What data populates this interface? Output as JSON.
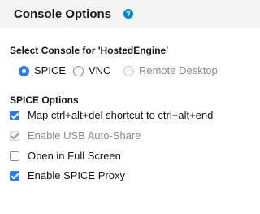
{
  "header": {
    "title": "Console Options",
    "help_icon": "?"
  },
  "console_select": {
    "label": "Select Console for 'HostedEngine'",
    "options": [
      {
        "label": "SPICE",
        "selected": true,
        "disabled": false
      },
      {
        "label": "VNC",
        "selected": false,
        "disabled": false
      },
      {
        "label": "Remote Desktop",
        "selected": false,
        "disabled": true
      }
    ]
  },
  "spice_options": {
    "label": "SPICE Options",
    "items": [
      {
        "label": "Map ctrl+alt+del shortcut to ctrl+alt+end",
        "checked": true,
        "disabled": false
      },
      {
        "label": "Enable USB Auto-Share",
        "checked": true,
        "disabled": true
      },
      {
        "label": "Open in Full Screen",
        "checked": false,
        "disabled": false
      },
      {
        "label": "Enable SPICE Proxy",
        "checked": true,
        "disabled": false
      }
    ]
  },
  "colors": {
    "accent": "#2f7ae5",
    "help_icon": "#0088ce",
    "header_bg": "#f3f3f3"
  }
}
